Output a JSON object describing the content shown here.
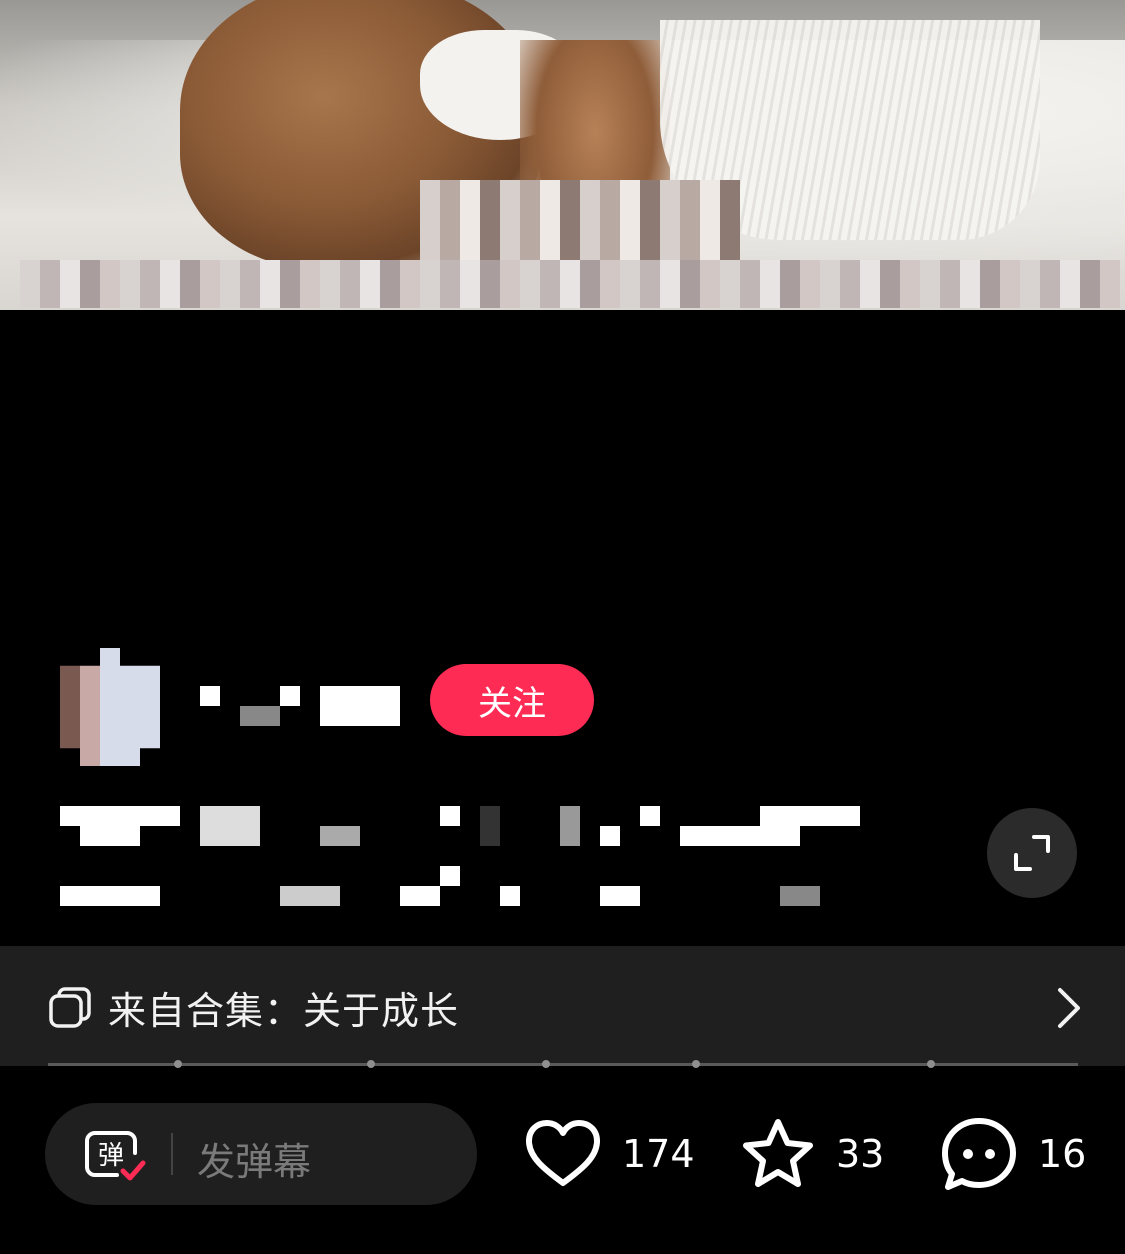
{
  "author": {
    "follow_label": "关注"
  },
  "collection": {
    "label": "来自合集：关于成长"
  },
  "danmu": {
    "icon_char": "弹",
    "placeholder": "发弹幕"
  },
  "actions": {
    "likes": "174",
    "favorites": "33",
    "comments": "16"
  },
  "icons": {
    "expand": "expand-icon",
    "collection": "collection-icon",
    "chevron": "chevron-right-icon",
    "heart": "heart-icon",
    "star": "star-icon",
    "comment": "comment-icon"
  },
  "colors": {
    "follow_button": "#fe2c55",
    "background": "#000000",
    "panel": "#1f1f1f",
    "danmu_check": "#fe2c55"
  }
}
